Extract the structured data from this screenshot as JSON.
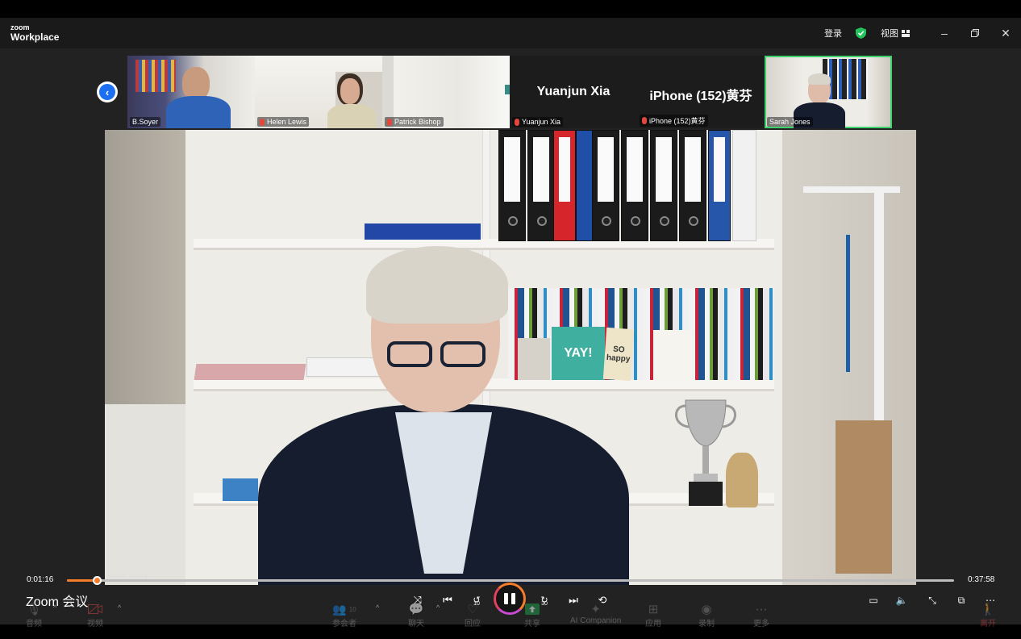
{
  "app": {
    "logo_line1": "zoom",
    "logo_line2": "Workplace",
    "signin_label": "登录",
    "view_label": "视图",
    "accent": "#f47c2a",
    "active_speaker_color": "#3dd26e"
  },
  "participants": [
    {
      "name": "B.Soyer",
      "type": "video",
      "muted": false
    },
    {
      "name": "Helen Lewis",
      "type": "video",
      "muted": true
    },
    {
      "name": "Patrick Bishop",
      "type": "video",
      "muted": true
    },
    {
      "name": "Yuanjun Xia",
      "display": "Yuanjun Xia",
      "type": "name-only",
      "muted": true
    },
    {
      "name": "iPhone (152)黄芬",
      "display": "iPhone (152)黄芬",
      "type": "name-only",
      "muted": true
    },
    {
      "name": "Sarah Jones",
      "type": "video",
      "muted": false,
      "active": true
    }
  ],
  "main_video": {
    "speaker": "Sarah Jones",
    "card_yay": "YAY!",
    "card_so": "SO happy"
  },
  "player": {
    "current_time": "0:01:16",
    "total_time": "0:37:58",
    "progress": 0.034
  },
  "meeting_title": "Zoom 会议",
  "toolbar": {
    "audio": "音频",
    "video": "视频",
    "participants": "参会者",
    "participant_count": "10",
    "chat": "聊天",
    "reactions": "回应",
    "share": "共享",
    "ai_companion": "AI Companion",
    "apps": "应用",
    "record": "录制",
    "more": "更多",
    "leave": "离开",
    "rewind_label": "10",
    "forward_label": "30"
  }
}
